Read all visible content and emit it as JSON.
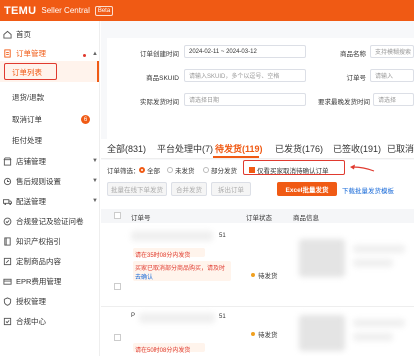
{
  "topbar": {
    "brand": "TEMU",
    "subtitle": "Seller Central",
    "beta": "Beta"
  },
  "sidebar": {
    "home": "首页",
    "order_mgmt": "订单管理",
    "sub_items": [
      "订单列表",
      "退货/退款",
      "取消订单",
      "拒付处理"
    ],
    "cancel_badge": "6",
    "groups": [
      "店铺管理",
      "售后规则设置",
      "配送管理",
      "合规登记及验证问卷",
      "知识产权指引",
      "定制商品内容",
      "EPR费用管理",
      "授权管理",
      "合规中心"
    ]
  },
  "filters": {
    "order_create_time_label": "订单创建时间",
    "order_create_time_value": "2024-02-11 ~ 2024-03-12",
    "product_name_label": "商品名称",
    "product_name_placeholder": "支持模糊搜索",
    "skuid_label": "商品SKUID",
    "skuid_placeholder": "请输入SKUID，多个以逗号、空格",
    "order_no_label": "订单号",
    "order_no_placeholder": "请输入",
    "actual_ship_label": "实际发货时间",
    "actual_ship_placeholder": "请选择日期",
    "latest_ship_label": "要求最晚发货时间",
    "latest_ship_placeholder": "请选择"
  },
  "tabs": [
    "全部(831)",
    "平台处理中(7)",
    "待发货(119)",
    "已发货(176)",
    "已签收(191)",
    "已取消"
  ],
  "filter_row": {
    "label": "订单筛选：",
    "options": [
      "全部",
      "未发货",
      "部分发货"
    ],
    "checkbox_label": "仅看买家取消待确认订单"
  },
  "actions": {
    "batch_ship": "批量在线下单发货",
    "merge_ship": "合并发货",
    "unpacked": "拆出订单",
    "excel_batch": "Excel批量发货",
    "download_template": "下载批量发货模板"
  },
  "table": {
    "headers": [
      "订单号",
      "订单状态",
      "商品信息"
    ],
    "rows": [
      {
        "order_suffix": "51",
        "deadline_notice": "请在35时08分内发货",
        "partial_notice": "买家已取消部分商品购买，请及时",
        "confirm_link": "去确认",
        "status": "待发货"
      },
      {
        "order_prefix": "P",
        "order_suffix": "51",
        "deadline_notice": "请在50时08分内发货",
        "status": "待发货"
      }
    ]
  },
  "colors": {
    "accent": "#f05a14",
    "highlight": "#e03a2f"
  }
}
